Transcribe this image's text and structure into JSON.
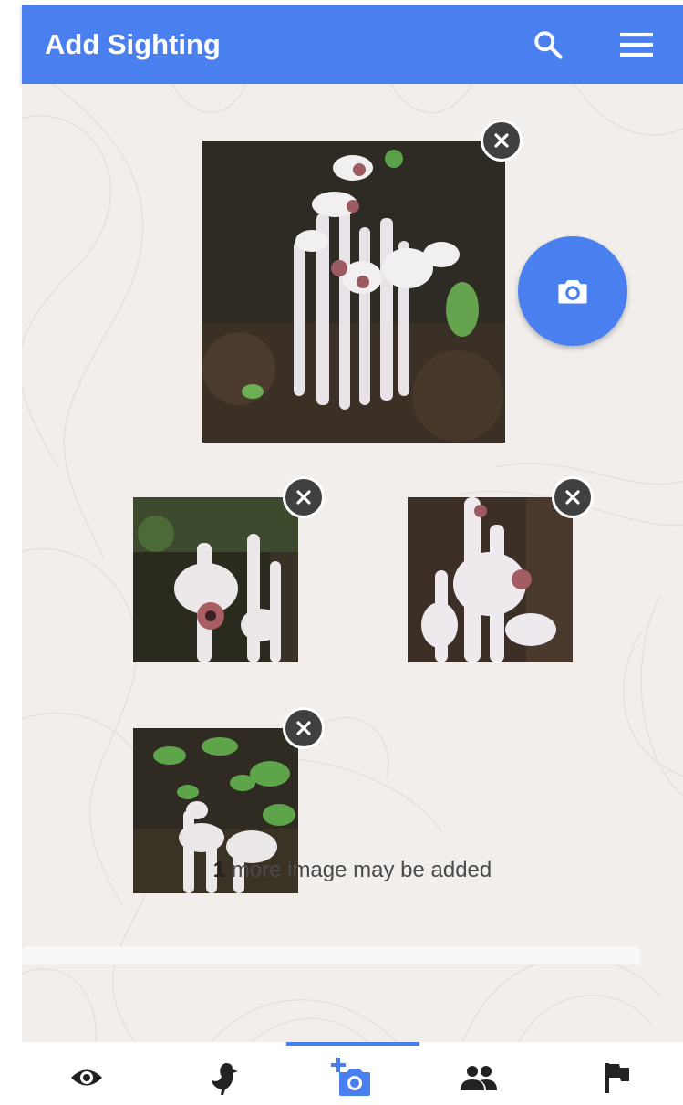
{
  "header": {
    "title": "Add Sighting"
  },
  "photos": [
    {
      "alt": "photo-1"
    },
    {
      "alt": "photo-2"
    },
    {
      "alt": "photo-3"
    },
    {
      "alt": "photo-4"
    }
  ],
  "footer_note": {
    "count": "1",
    "text": " more image may be added"
  },
  "icons": {
    "search": "search-icon",
    "menu": "menu-icon",
    "camera": "camera-icon",
    "close": "close-icon",
    "nav": [
      "eye-icon",
      "bird-icon",
      "add-photo-icon",
      "people-icon",
      "flag-icon"
    ]
  },
  "colors": {
    "accent": "#4a7ff0",
    "background": "#f1eeeb",
    "nav_icon": "#222222",
    "remove_button": "#404040"
  },
  "bottom_nav": {
    "active_index": 2
  }
}
